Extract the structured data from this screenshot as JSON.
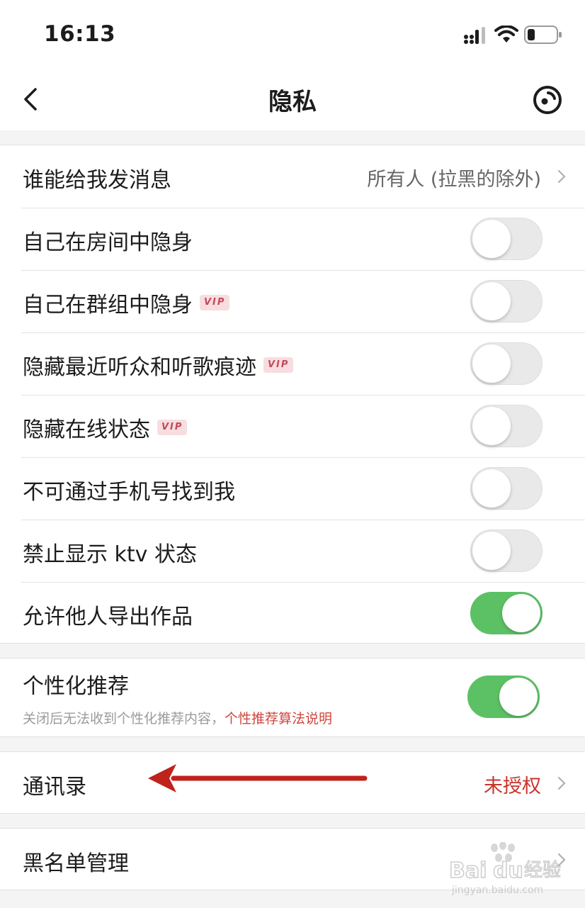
{
  "status_bar": {
    "time": "16:13"
  },
  "navbar": {
    "title": "隐私"
  },
  "settings": {
    "message_permission": {
      "label": "谁能给我发消息",
      "value": "所有人 (拉黑的除外)"
    },
    "toggles": [
      {
        "label": "自己在房间中隐身",
        "vip": "",
        "on": false
      },
      {
        "label": "自己在群组中隐身",
        "vip": "VIP",
        "on": false
      },
      {
        "label": "隐藏最近听众和听歌痕迹",
        "vip": "VIP",
        "on": false
      },
      {
        "label": "隐藏在线状态",
        "vip": "VIP",
        "on": false
      },
      {
        "label": "不可通过手机号找到我",
        "vip": "",
        "on": false
      },
      {
        "label": "禁止显示 ktv 状态",
        "vip": "",
        "on": false
      },
      {
        "label": "允许他人导出作品",
        "vip": "",
        "on": true
      }
    ],
    "personalized": {
      "label": "个性化推荐",
      "note": "关闭后无法收到个性化推荐内容，",
      "link": "个性推荐算法说明",
      "on": true
    },
    "contacts": {
      "label": "通讯录",
      "value": "未授权"
    },
    "blacklist": {
      "label": "黑名单管理"
    }
  },
  "watermark": {
    "brand": "Bai",
    "brand2": "du",
    "cn": "经验",
    "url": "jingyan.baidu.com"
  },
  "colors": {
    "toggle_on": "#5cc165",
    "accent_red": "#c8352c",
    "annotation_arrow": "#c0221c"
  }
}
